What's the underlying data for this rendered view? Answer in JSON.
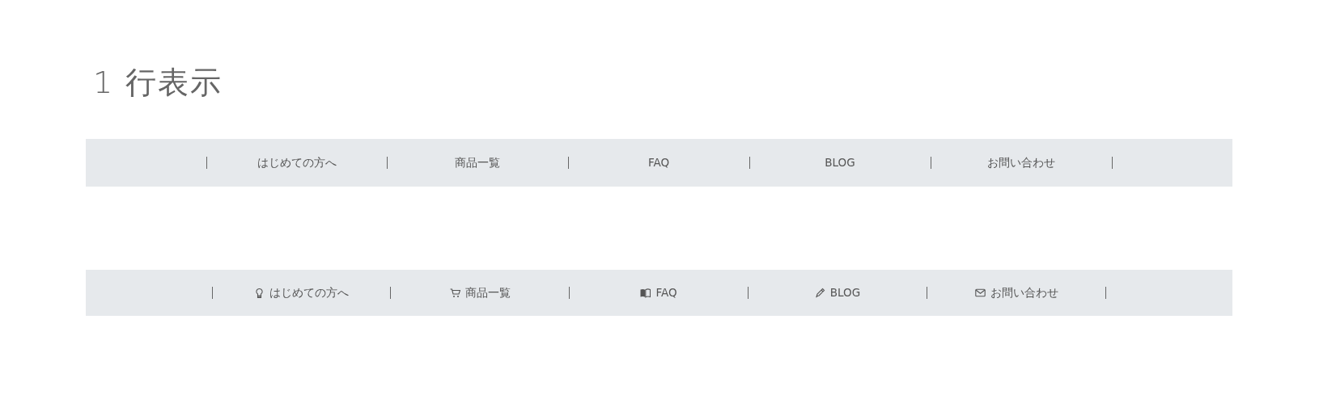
{
  "heading": "1 行表示",
  "navs": [
    {
      "icons": false,
      "items": [
        "はじめての方へ",
        "商品一覧",
        "FAQ",
        "BLOG",
        "お問い合わせ"
      ]
    },
    {
      "icons": true,
      "items": [
        "はじめての方へ",
        "商品一覧",
        "FAQ",
        "BLOG",
        "お問い合わせ"
      ]
    }
  ]
}
